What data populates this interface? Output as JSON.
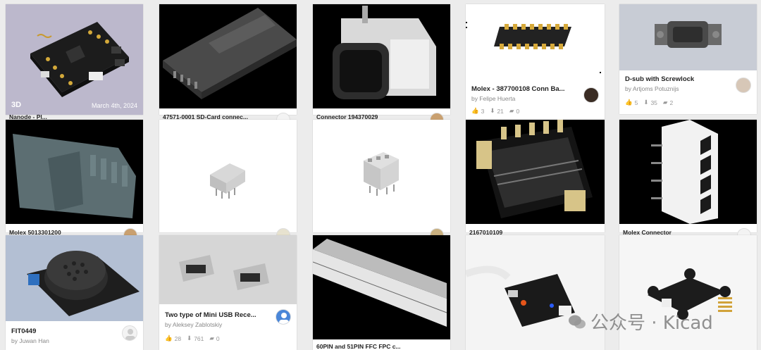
{
  "cards": {
    "c1": {
      "title": "Nanode - Pl...",
      "badge": "3D",
      "date": "March 4th, 2024"
    },
    "c2": {
      "title": "47571-0001 SD-Card connec..."
    },
    "c3": {
      "title": "Connector 194370029"
    },
    "c4": {
      "title": "Molex - 387700108 Conn Ba...",
      "author": "by Felipe Huerta",
      "likes": "3",
      "downloads": "21",
      "comments": "0"
    },
    "c5": {
      "title": "D-sub with Screwlock",
      "author": "by Artjoms Potuznijs",
      "likes": "5",
      "downloads": "35",
      "comments": "2"
    },
    "c6": {
      "title": "Molex 5013301200"
    },
    "c9": {
      "title": "2167010109"
    },
    "c10": {
      "title": "Molex Connector"
    },
    "c11": {
      "title": "FIT0449",
      "author": "by Juwan Han"
    },
    "c12": {
      "title": "Two type of Mini USB Rece...",
      "author": "by Aleksey Zablotskiy",
      "likes": "28",
      "downloads": "761",
      "comments": "0"
    },
    "c13": {
      "title": "60PIN and 51PIN FFC FPC c..."
    }
  },
  "watermark": {
    "text": "公众号 · Kicad"
  },
  "colors": {
    "stats": "#999999",
    "title": "#222222",
    "author": "#888888",
    "background": "#ececec"
  }
}
